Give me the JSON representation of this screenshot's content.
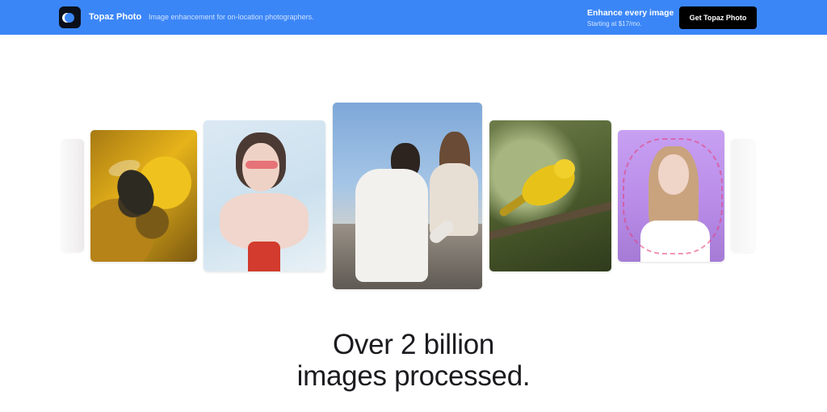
{
  "header": {
    "brand": "Topaz Photo",
    "tagline": "Image enhancement for on-location photographers.",
    "promo_title": "Enhance every image",
    "promo_subtitle": "Starting at $17/mo.",
    "cta_label": "Get Topaz Photo",
    "background_color": "#3b86f7",
    "logo_icon": "topaz-logo-icon"
  },
  "gallery": {
    "images": [
      {
        "subject": "faded-left-image"
      },
      {
        "subject": "bee-on-yellow-flower"
      },
      {
        "subject": "woman-with-red-eye-makeup"
      },
      {
        "subject": "two-women-sitting-on-wall"
      },
      {
        "subject": "yellow-bird-on-branch"
      },
      {
        "subject": "woman-with-pink-writing"
      },
      {
        "subject": "faded-right-image"
      }
    ]
  },
  "hero": {
    "line1": "Over 2 billion",
    "line2": "images processed."
  }
}
